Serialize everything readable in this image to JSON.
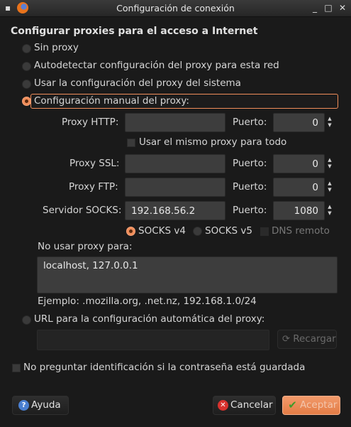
{
  "window": {
    "title": "Configuración de conexión",
    "menu_glyph": "▪",
    "minimize_glyph": "_",
    "maximize_glyph": "□",
    "close_glyph": "✕"
  },
  "heading": "Configurar proxies para el acceso a Internet",
  "options": {
    "no_proxy": "Sin proxy",
    "autodetect": "Autodetectar configuración del proxy para esta red",
    "system": "Usar la configuración del proxy del sistema",
    "manual": "Configuración manual del proxy:"
  },
  "manual": {
    "http_label": "Proxy HTTP:",
    "http_value": "",
    "http_port_label": "Puerto:",
    "http_port": "0",
    "same_proxy": "Usar el mismo proxy para todo",
    "ssl_label": "Proxy SSL:",
    "ssl_value": "",
    "ssl_port_label": "Puerto:",
    "ssl_port": "0",
    "ftp_label": "Proxy FTP:",
    "ftp_value": "",
    "ftp_port_label": "Puerto:",
    "ftp_port": "0",
    "socks_label": "Servidor SOCKS:",
    "socks_value": "192.168.56.2",
    "socks_port_label": "Puerto:",
    "socks_port": "1080",
    "socks_v4": "SOCKS v4",
    "socks_v5": "SOCKS v5",
    "remote_dns": "DNS remoto",
    "no_proxy_label": "No usar proxy para:",
    "no_proxy_value": "localhost, 127.0.0.1",
    "example": "Ejemplo: .mozilla.org, .net.nz, 192.168.1.0/24"
  },
  "auto_url": {
    "label": "URL para la configuración automática del proxy:",
    "value": "",
    "reload": "Recargar"
  },
  "no_prompt": "No preguntar identificación si la contraseña está guardada",
  "buttons": {
    "help": "Ayuda",
    "cancel": "Cancelar",
    "accept": "Aceptar"
  },
  "colors": {
    "accent": "#f08e5a",
    "background": "#1a1a1a",
    "field": "#3d3d3d"
  }
}
